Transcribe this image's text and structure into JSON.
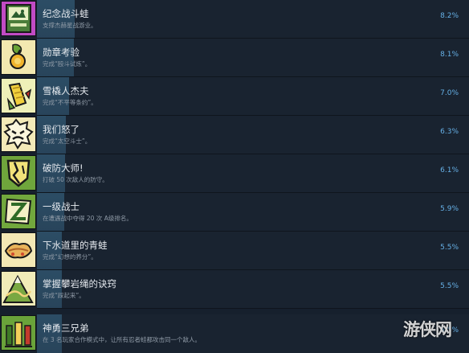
{
  "achievements": [
    {
      "title": "纪念战斗蛙",
      "desc": "支撑杰赫星战游业。",
      "percent": "8.2%",
      "value": 8.2,
      "icon": "frog-poster-icon",
      "icon_bg": "#c14bc5"
    },
    {
      "title": "勋章考验",
      "desc": "完成“殴斗试炼”。",
      "percent": "8.1%",
      "value": 8.1,
      "icon": "medal-icon",
      "icon_bg": "#f2e8b0"
    },
    {
      "title": "雪橇人杰夫",
      "desc": "完成“不平等条约”。",
      "percent": "7.0%",
      "value": 7.0,
      "icon": "corn-sled-icon",
      "icon_bg": "#eef0b8"
    },
    {
      "title": "我们怒了",
      "desc": "完成“太空斗士”。",
      "percent": "6.3%",
      "value": 6.3,
      "icon": "angry-burst-icon",
      "icon_bg": "#f3eab8"
    },
    {
      "title": "破防大师!",
      "desc": "打破 50 次敌人的防守。",
      "percent": "6.1%",
      "value": 6.1,
      "icon": "broken-shield-icon",
      "icon_bg": "#6fa53c"
    },
    {
      "title": "一级战士",
      "desc": "在遭遇战中夺得 20 次 A级排名。",
      "percent": "5.9%",
      "value": 5.9,
      "icon": "rank-a-icon",
      "icon_bg": "#72a83d"
    },
    {
      "title": "下水道里的青蛙",
      "desc": "完成“幻想的养分”。",
      "percent": "5.5%",
      "value": 5.5,
      "icon": "sewer-frog-icon",
      "icon_bg": "#f3e8b5"
    },
    {
      "title": "掌握攀岩绳的诀窍",
      "desc": "完成“踩起来”。",
      "percent": "5.5%",
      "value": 5.5,
      "icon": "mountain-rope-icon",
      "icon_bg": "#f1ecb8"
    },
    {
      "title": "神勇三兄弟",
      "desc": "在 3 名玩家合作模式中，让所有忍者蛙都攻击同一个敌人。",
      "percent": "5.5%",
      "value": 5.5,
      "icon": "three-brothers-icon",
      "icon_bg": "#6aa33a"
    }
  ],
  "watermark": "游侠网"
}
